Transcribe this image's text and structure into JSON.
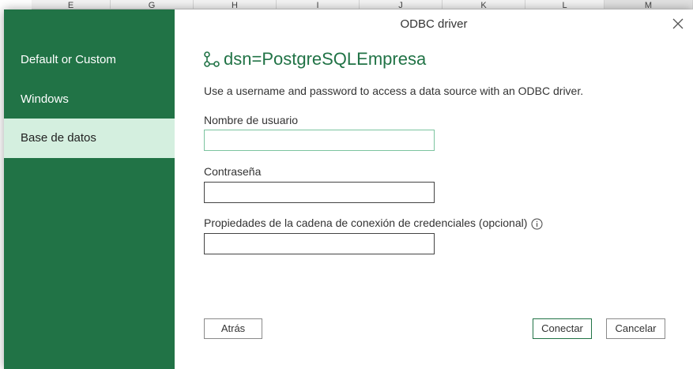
{
  "spreadsheet": {
    "columns": [
      "E",
      "G",
      "H",
      "I",
      "J",
      "K",
      "L",
      "M"
    ],
    "active_column": "M"
  },
  "dialog": {
    "title": "ODBC driver",
    "close_icon": "close-icon",
    "sidebar": {
      "items": [
        {
          "label": "Default or Custom",
          "selected": false
        },
        {
          "label": "Windows",
          "selected": false
        },
        {
          "label": "Base de datos",
          "selected": true
        }
      ]
    },
    "dsn": {
      "icon": "connection-icon",
      "text": "dsn=PostgreSQLEmpresa"
    },
    "description": "Use a username and password to access a data source with an ODBC driver.",
    "fields": {
      "username_label": "Nombre de usuario",
      "username_value": "",
      "password_label": "Contraseña",
      "password_value": "",
      "credentials_label": "Propiedades de la cadena de conexión de credenciales (opcional)",
      "credentials_value": ""
    },
    "buttons": {
      "back": "Atrás",
      "connect": "Conectar",
      "cancel": "Cancelar"
    }
  },
  "colors": {
    "accent": "#217346",
    "selected_nav": "#d4efdf",
    "focus_border": "#7cc4a0"
  }
}
